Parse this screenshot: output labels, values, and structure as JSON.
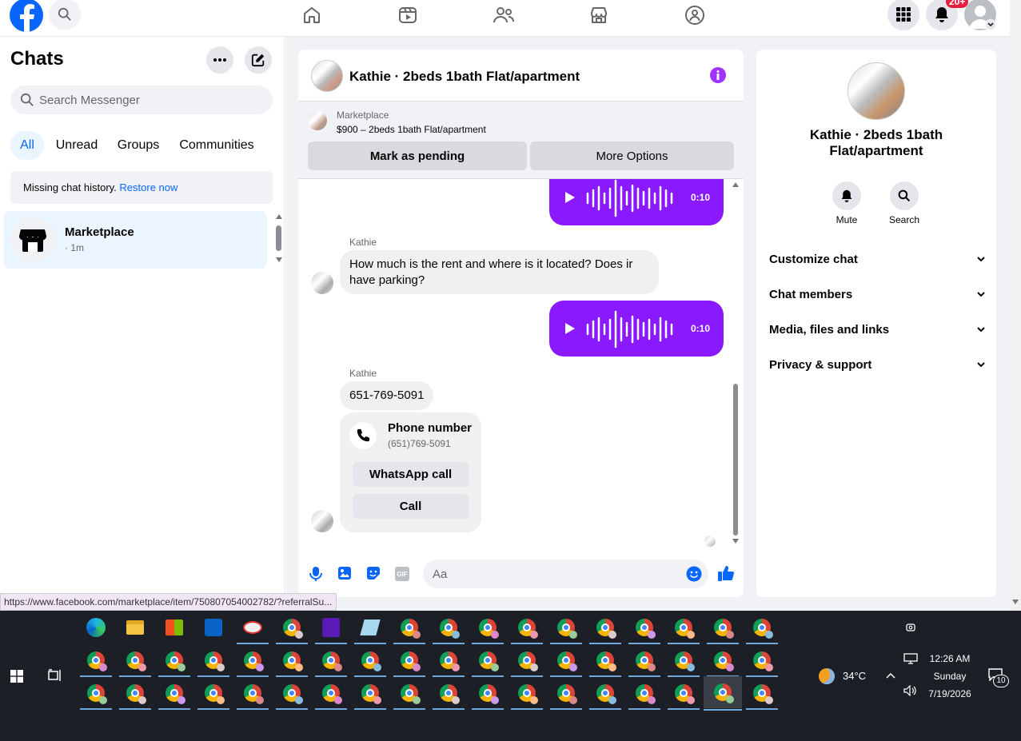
{
  "topbar": {
    "notification_badge": "20+"
  },
  "chats": {
    "title": "Chats",
    "search_placeholder": "Search Messenger",
    "filters": [
      "All",
      "Unread",
      "Groups",
      "Communities"
    ],
    "missing_history_text": "Missing chat history.",
    "restore_link": "Restore now",
    "list": [
      {
        "name": "Marketplace",
        "time": "· 1m"
      }
    ]
  },
  "conversation": {
    "title": "Kathie · 2beds 1bath Flat/apartment",
    "marketplace_label": "Marketplace",
    "listing_text": "$900 – 2beds 1bath Flat/apartment",
    "mark_pending": "Mark as pending",
    "more_options": "More Options",
    "messages": [
      {
        "type": "voice",
        "duration": "0:10"
      },
      {
        "sender": "Kathie",
        "text": "How much is the rent and where is it located? Does ir have parking?"
      },
      {
        "type": "voice",
        "duration": "0:10"
      },
      {
        "sender": "Kathie",
        "text": "651-769-5091"
      }
    ],
    "phone_card": {
      "title": "Phone number",
      "number": "(651)769-5091",
      "whatsapp": "WhatsApp call",
      "call": "Call"
    },
    "composer_placeholder": "Aa"
  },
  "details": {
    "name": "Kathie · 2beds 1bath Flat/apartment",
    "mute": "Mute",
    "search": "Search",
    "sections": [
      "Customize chat",
      "Chat members",
      "Media, files and links",
      "Privacy & support"
    ]
  },
  "status_url": "https://www.facebook.com/marketplace/item/750807054002782/?referralSu...",
  "taskbar": {
    "weather": "34°C",
    "time": "12:26 AM",
    "day": "Sunday",
    "date": "7/19/2026",
    "notifications": "10"
  },
  "colors": {
    "fb_blue": "#0866ff",
    "messenger_purple": "#8a19ff",
    "info_purple": "#a033ff"
  }
}
